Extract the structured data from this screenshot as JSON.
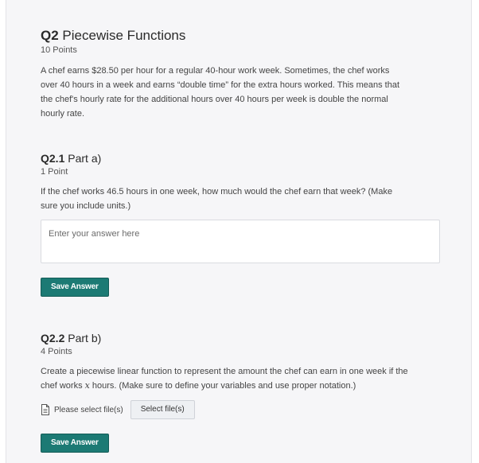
{
  "q2": {
    "number": "Q2",
    "title": "Piecewise Functions",
    "points": "10 Points",
    "prompt_lines": [
      "A chef earns $28.50 per hour for a regular 40-hour work week.  Sometimes, the chef works",
      "over 40 hours in a week and earns “double time” for the extra hours worked.  This means that",
      "the chef's hourly rate for the additional hours over 40 hours per week is double the normal",
      "hourly rate."
    ]
  },
  "q2_1": {
    "number": "Q2.1",
    "title": "Part a)",
    "points": "1 Point",
    "prompt_lines": [
      "If the chef works 46.5 hours in one week, how much would the chef earn that week? (Make",
      "sure you include units.)"
    ],
    "answer_value": "",
    "answer_placeholder": "Enter your answer here",
    "save_label": "Save Answer"
  },
  "q2_2": {
    "number": "Q2.2",
    "title": "Part b)",
    "points": "4 Points",
    "prompt_line1": "Create a piecewise linear function to represent the amount the chef can earn in one week if the",
    "prompt_line2_pre": "chef works ",
    "prompt_line2_var": "x",
    "prompt_line2_post": " hours. (Make sure to define your variables and use proper notation.)",
    "file_label": "Please select file(s)",
    "select_label": "Select file(s)",
    "save_label": "Save Answer"
  },
  "icons": {
    "file": "file-icon"
  },
  "colors": {
    "accent": "#1c7a74",
    "background": "#f6f6f8"
  }
}
